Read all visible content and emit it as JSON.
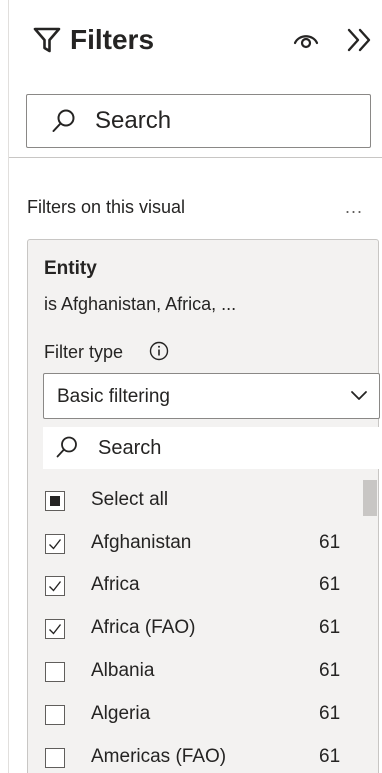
{
  "pane": {
    "title": "Filters",
    "icons": {
      "filter": "funnel-icon",
      "visibility": "eye-icon",
      "collapse": "double-chevron-right-icon"
    }
  },
  "search": {
    "placeholder": "Search"
  },
  "section": {
    "title": "Filters on this visual",
    "more": "..."
  },
  "filter_card": {
    "field": "Entity",
    "summary": "is Afghanistan, Africa, ...",
    "filter_type_label": "Filter type",
    "filter_type_value": "Basic filtering",
    "list_search_placeholder": "Search",
    "items": [
      {
        "label": "Select all",
        "count": "",
        "state": "partial"
      },
      {
        "label": "Afghanistan",
        "count": "61",
        "state": "checked"
      },
      {
        "label": "Africa",
        "count": "61",
        "state": "checked"
      },
      {
        "label": "Africa (FAO)",
        "count": "61",
        "state": "checked"
      },
      {
        "label": "Albania",
        "count": "61",
        "state": "unchecked"
      },
      {
        "label": "Algeria",
        "count": "61",
        "state": "unchecked"
      },
      {
        "label": "Americas (FAO)",
        "count": "61",
        "state": "unchecked"
      }
    ]
  }
}
